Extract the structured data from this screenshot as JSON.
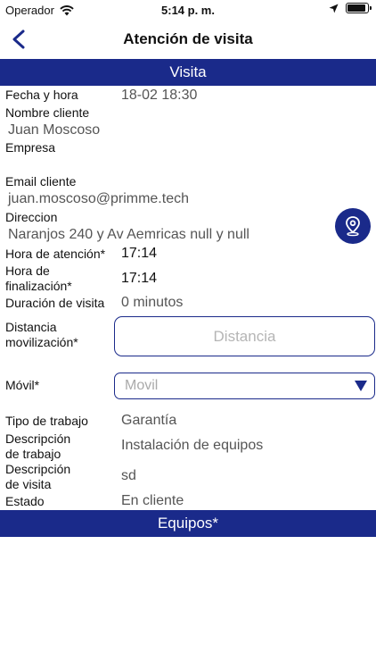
{
  "status_bar": {
    "carrier": "Operador",
    "time": "5:14 p. m.",
    "battery_level": 0.9
  },
  "nav": {
    "title": "Atención de visita"
  },
  "sections": {
    "visita": "Visita",
    "equipos": "Equipos*"
  },
  "fields": {
    "fecha_label": "Fecha y hora",
    "fecha_value": "18-02 18:30",
    "nombre_label": "Nombre cliente",
    "nombre_value": "Juan Moscoso",
    "empresa_label": "Empresa",
    "email_label": "Email cliente",
    "email_value": "juan.moscoso@primme.tech",
    "direccion_label": "Direccion",
    "direccion_value": "Naranjos 240 y Av Aemricas null y null",
    "hora_atencion_label": "Hora de atención*",
    "hora_atencion_value": "17:14",
    "hora_fin_label_1": "Hora de",
    "hora_fin_label_2": "finalización*",
    "hora_fin_value": "17:14",
    "duracion_label": "Duración de visita",
    "duracion_value": "0 minutos",
    "distancia_label_1": "Distancia",
    "distancia_label_2": "movilización*",
    "distancia_placeholder": "Distancia",
    "movil_label": "Móvil*",
    "movil_placeholder": "Movil",
    "tipo_label": "Tipo de trabajo",
    "tipo_value": "Garantía",
    "desc_trabajo_label_1": "Descripción",
    "desc_trabajo_label_2": "de trabajo",
    "desc_trabajo_value": "Instalación de equipos",
    "desc_visita_label_1": "Descripción",
    "desc_visita_label_2": "de visita",
    "desc_visita_value": "sd",
    "estado_label": "Estado",
    "estado_value": "En cliente"
  },
  "icons": {
    "wifi": "wifi-icon",
    "location_arrow": "location-arrow-icon",
    "battery": "battery-icon",
    "back": "chevron-left-icon",
    "map_pin": "map-pin-icon",
    "dropdown": "dropdown-arrow-icon"
  },
  "colors": {
    "primary": "#1a2a8a",
    "muted_text": "#555555",
    "placeholder": "#b5b5b5"
  }
}
